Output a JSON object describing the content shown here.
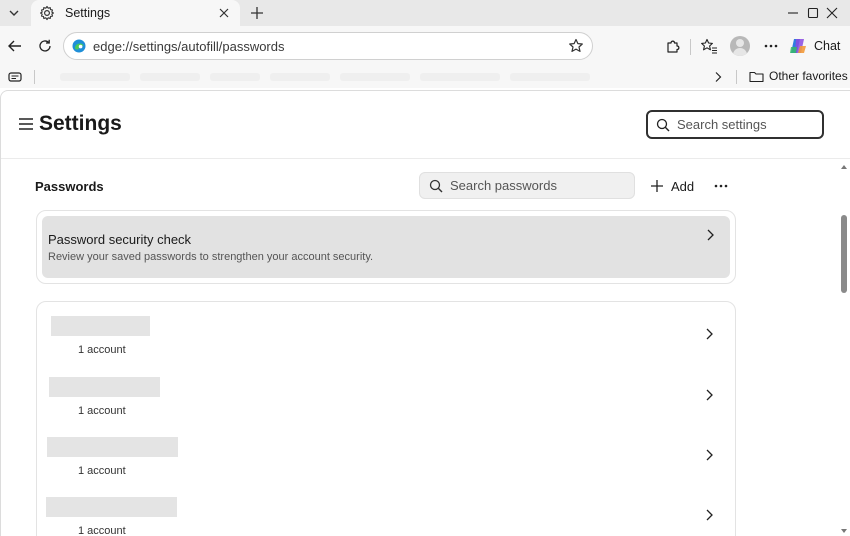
{
  "browser": {
    "tab": {
      "title": "Settings"
    },
    "address": {
      "url": "edge://settings/autofill/passwords"
    },
    "chat_label": "Chat",
    "favorites": {
      "other_label": "Other favorites"
    }
  },
  "settings": {
    "title": "Settings",
    "search": {
      "placeholder": "Search settings"
    }
  },
  "passwords": {
    "section_title": "Passwords",
    "search_placeholder": "Search passwords",
    "add_label": "Add",
    "security_check": {
      "title": "Password security check",
      "subtitle": "Review your saved passwords to strengthen your account security."
    },
    "items": [
      {
        "count": "1 account"
      },
      {
        "count": "1 account"
      },
      {
        "count": "1 account"
      },
      {
        "count": "1 account"
      }
    ]
  },
  "colors": {
    "accent": "#0c59a4",
    "card_bg": "#e2e2e2",
    "tabstrip_bg": "#e8e8e8"
  }
}
